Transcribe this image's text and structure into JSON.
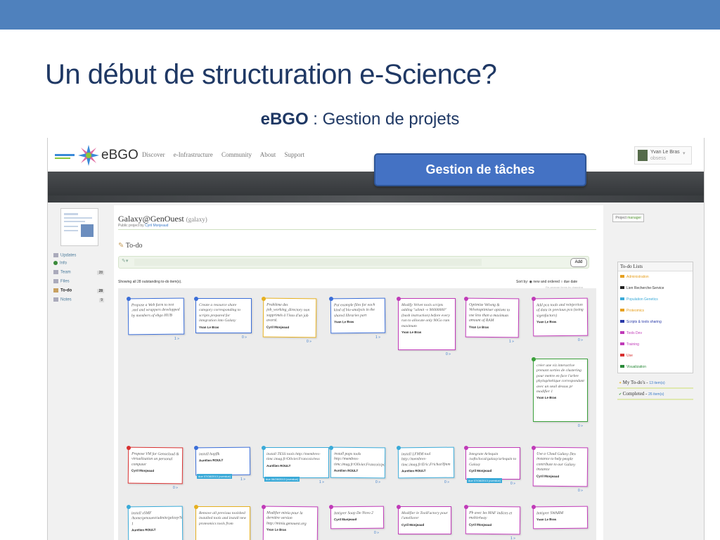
{
  "slide": {
    "title": "Un début de structuration e-Science?",
    "subtitle_bold": "eBGO",
    "subtitle_rest": " : Gestion de projets",
    "callout": "Gestion de tâches"
  },
  "app": {
    "brand": "eBGO",
    "nav": [
      "Discover",
      "e-Infrastructure",
      "Community",
      "About",
      "Support"
    ],
    "user": {
      "name": "Yvan Le Bras",
      "link": "obsess"
    }
  },
  "sidebar": {
    "items": [
      {
        "label": "Updates",
        "count": ""
      },
      {
        "label": "Info",
        "count": ""
      },
      {
        "label": "Team",
        "count": "28"
      },
      {
        "label": "Files",
        "count": ""
      },
      {
        "label": "To-do",
        "count": "28"
      },
      {
        "label": "Notes",
        "count": "9"
      }
    ]
  },
  "project": {
    "title": "Galaxy@GenOuest",
    "slug": "(galaxy)",
    "public_prefix": "Public project by ",
    "owner": "Cyril Monjeaud",
    "role_prefix": "Project ",
    "role": "manager",
    "todo_heading": "To-do",
    "add_label": "Add",
    "showing": "Showing all 28 outstanding to-do item(s).",
    "sort_label": "Sort by:",
    "sort_options": [
      "new and ordered",
      "due date"
    ],
    "drag_hint": "Re-arrange items by dragging"
  },
  "cards": [
    {
      "text": "Propose a Web form to test .xml and wrappers developped by members of ebgo HUB",
      "who": "",
      "due": "",
      "foot": "1 »",
      "color": "#3b6ed8"
    },
    {
      "text": "Create a resource share category corresponding to scripts prepared for integration into Galaxy",
      "who": "Yvan Le Bras",
      "due": "",
      "foot": "0 »",
      "color": "#3b6ed8"
    },
    {
      "text": "Problème des job_working_directory non supprimés à l'issu d'un job avorté.",
      "who": "Cyril Monjeaud",
      "due": "",
      "foot": "0 »",
      "color": "#e6b020"
    },
    {
      "text": "Put example files for each kind of bio-analysis in the shared libraries part",
      "who": "Yvan Le Bras",
      "due": "",
      "foot": "1 »",
      "color": "#3b6ed8"
    },
    {
      "text": "Modify Velvet tools scripts adding \"ulimit -v 90000000\" (bash instruction) before every run to allocate only 90Go ram maximum",
      "who": "Yvan Le Bras",
      "due": "",
      "foot": "0 »",
      "color": "#c03ab8"
    },
    {
      "text": "Optimize Velvetg & Velvetoptimiser options to use less than a maximum amount of RAM",
      "who": "Yvan Le Bras",
      "due": "",
      "foot": "1 »",
      "color": "#c03ab8"
    },
    {
      "text": "Add pca tools and reinjection of data in previous pca (using sigenfactors)",
      "who": "Yvan Le Bras",
      "due": "",
      "foot": "0 »",
      "color": "#c03ab8"
    },
    {
      "text": "créer une viz interactive prenant sorties de clustering pour mettre en face l'arbre phylogénétique correspondant avec un seuil dessus pr modifier 1",
      "who": "Yvan Le Bras",
      "due": "",
      "foot": "0 »",
      "color": "#3aa03a"
    },
    {
      "text": "Propose VM for Genocloud & virtualization on personal computer",
      "who": "Cyril Monjeaud",
      "due": "",
      "foot": "0 »",
      "color": "#d83030"
    },
    {
      "text": "install hapflk",
      "who": "Aurélien ROULT",
      "due": "due 07/08/2013 (overdue)",
      "foot": "1 »",
      "color": "#3b6ed8"
    },
    {
      "text": "install TESS tools http://membres-timc.imag.fr/Olivier.Francois/tess",
      "who": "Aurélien ROULT",
      "due": "due 06/28/2013 (overdue)",
      "foot": "1 »",
      "color": "#3aaad8"
    },
    {
      "text": "install pops tools http://membres-timc.imag.fr/Olivier.Francois/pops",
      "who": "Aurélien ROULT",
      "due": "",
      "foot": "0 »",
      "color": "#3aaad8"
    },
    {
      "text": "install LFMM tool http://membres-timc.imag.fr/Eric.Frichot/lfmm",
      "who": "Aurélien ROULT",
      "due": "",
      "foot": "0 »",
      "color": "#3aaad8"
    },
    {
      "text": "Integrate Arlequin /softs/local/galaxy/arlequin to Galaxy",
      "who": "Cyril Monjeaud",
      "due": "due 07/08/2013 (overdue)",
      "foot": "0 »",
      "color": "#c03ab8"
    },
    {
      "text": "Use a Cloud Galaxy Dev instance to help people contribute to our Galaxy instance",
      "who": "Cyril Monjeaud",
      "due": "",
      "foot": "0 »",
      "color": "#c03ab8"
    },
    {
      "text": "install xSMF /home/genouest/admin/galaxy/Software 1",
      "who": "Aurélien ROULT",
      "due": "",
      "foot": "",
      "color": "#3aaad8"
    },
    {
      "text": "Remove all previous toolshed installed tools and install new proteomics tools from",
      "who": "",
      "due": "",
      "foot": "",
      "color": "#e6b020"
    },
    {
      "text": "Modifier minia pour la dernière version http://minia.genouest.org",
      "who": "Yvan Le Bras",
      "due": "",
      "foot": "",
      "color": "#c03ab8"
    },
    {
      "text": "Intégrer Soap De Novo 2",
      "who": "Cyril Monjeaud",
      "due": "",
      "foot": "0 »",
      "color": "#c03ab8"
    },
    {
      "text": "Modifier le ToolFactory pour l'améliorer",
      "who": "Cyril Monjeaud",
      "due": "",
      "foot": "",
      "color": "#c03ab8"
    },
    {
      "text": "Pb avec les MAF indices et multiz4way",
      "who": "Cyril Monjeaud",
      "due": "",
      "foot": "1 »",
      "color": "#c03ab8"
    },
    {
      "text": "Intégrer SWARM",
      "who": "Yvan Le Bras",
      "due": "",
      "foot": "",
      "color": "#c03ab8"
    }
  ],
  "todo_lists": {
    "heading": "To-do Lists",
    "items": [
      {
        "label": "Administration",
        "color": "#e6a020"
      },
      {
        "label": "Lien Recherche-Service",
        "color": "#222222"
      },
      {
        "label": "Population Genetics",
        "color": "#3aaad8"
      },
      {
        "label": "Proteomics",
        "color": "#e6a020"
      },
      {
        "label": "Scripts & tools sharing",
        "color": "#2a3aa8"
      },
      {
        "label": "Tools Dev",
        "color": "#c03ab8"
      },
      {
        "label": "Training",
        "color": "#c03ab8"
      },
      {
        "label": "Use",
        "color": "#d83030"
      },
      {
        "label": "Visualization",
        "color": "#2a8a3a"
      }
    ],
    "my_todos_label": "My To-do's - ",
    "my_todos_count": "13 item(s)",
    "completed_label": "Completed - ",
    "completed_count": "26 item(s)"
  }
}
